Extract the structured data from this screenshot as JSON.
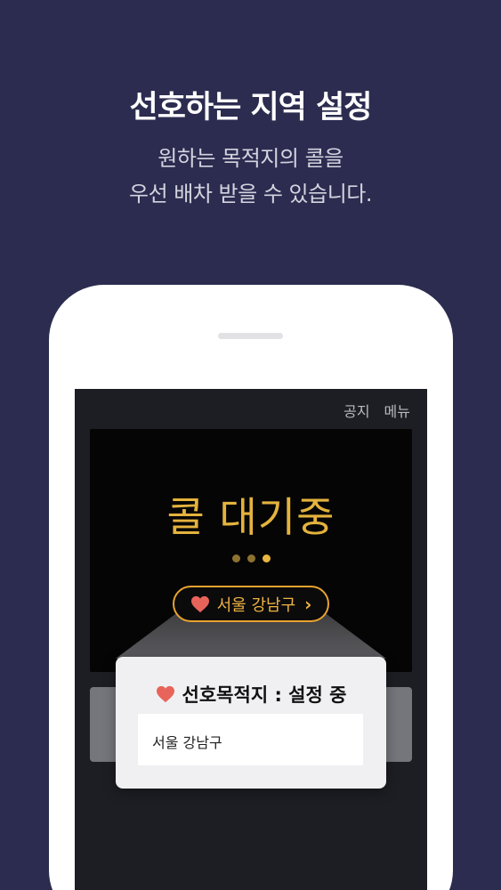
{
  "headline": "선호하는 지역 설정",
  "subtitle": {
    "line1": "원하는 목적지의 콜을",
    "line2": "우선 배차 받을 수 있습니다."
  },
  "phone": {
    "nav": {
      "notice_label": "공지",
      "menu_label": "메뉴"
    },
    "status_text": "콜 대기중",
    "loading_dots": 3,
    "active_dot": 3,
    "region_pill": {
      "icon": "heart-icon",
      "label": "서울 강남구",
      "chevron": "›"
    },
    "preferred_card": {
      "icon": "heart-icon",
      "title": "선호목적지 : 설정 중",
      "value": "서울 강남구"
    }
  },
  "colors": {
    "background": "#2b2c4f",
    "accent": "#e9b640",
    "heart": "#e8645a",
    "pill_border": "#e8a32f"
  }
}
